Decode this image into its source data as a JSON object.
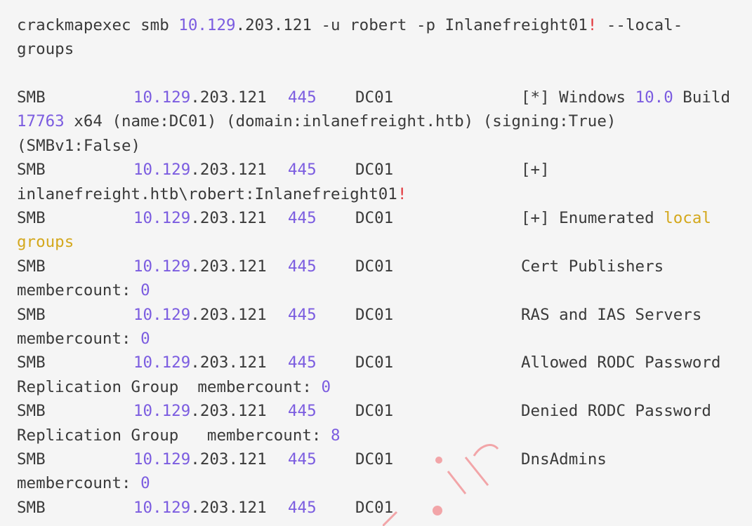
{
  "command": {
    "part1": "crackmapexec smb ",
    "ip_a": "10.129",
    "ip_b": ".203.121",
    "mid": " -u robert -p Inlanefreight01",
    "bang": "!",
    "end": " --local-",
    "line2": "groups"
  },
  "common": {
    "proto": "SMB",
    "ip_a": "10.129",
    "ip_b": ".203.121",
    "port": "445",
    "host": "DC01"
  },
  "rows": [
    {
      "parts": [
        {
          "text": "[*] Windows ",
          "style": ""
        },
        {
          "text": "10.0",
          "style": "num"
        },
        {
          "text": " Build",
          "style": ""
        }
      ],
      "wrap": [
        [
          {
            "text": "17763",
            "style": "num"
          },
          {
            "text": " x64 (name:DC01) (domain:inlanefreight.htb) (signing:True)",
            "style": ""
          }
        ],
        [
          {
            "text": "(SMBv1:False)",
            "style": ""
          }
        ]
      ]
    },
    {
      "parts": [
        {
          "text": "[+]",
          "style": ""
        }
      ],
      "wrap": [
        [
          {
            "text": "inlanefreight.htb\\robert:Inlanefreight01",
            "style": ""
          },
          {
            "text": "!",
            "style": "red"
          }
        ]
      ]
    },
    {
      "parts": [
        {
          "text": "[+] Enumerated ",
          "style": ""
        },
        {
          "text": "local",
          "style": "yel"
        }
      ],
      "wrap": [
        [
          {
            "text": "groups",
            "style": "yel"
          }
        ]
      ]
    },
    {
      "parts": [
        {
          "text": "Cert Publishers",
          "style": ""
        }
      ],
      "wrap": [
        [
          {
            "text": "membercount: ",
            "style": ""
          },
          {
            "text": "0",
            "style": "num"
          }
        ]
      ]
    },
    {
      "parts": [
        {
          "text": "RAS and IAS Servers",
          "style": ""
        }
      ],
      "wrap": [
        [
          {
            "text": "membercount: ",
            "style": ""
          },
          {
            "text": "0",
            "style": "num"
          }
        ]
      ]
    },
    {
      "parts": [
        {
          "text": "Allowed RODC Password",
          "style": ""
        }
      ],
      "wrap": [
        [
          {
            "text": "Replication Group  membercount: ",
            "style": ""
          },
          {
            "text": "0",
            "style": "num"
          }
        ]
      ]
    },
    {
      "parts": [
        {
          "text": "Denied RODC Password",
          "style": ""
        }
      ],
      "wrap": [
        [
          {
            "text": "Replication Group   membercount: ",
            "style": ""
          },
          {
            "text": "8",
            "style": "num"
          }
        ]
      ]
    },
    {
      "parts": [
        {
          "text": "DnsAdmins",
          "style": ""
        }
      ],
      "wrap": [
        [
          {
            "text": "membercount: ",
            "style": ""
          },
          {
            "text": "0",
            "style": "num"
          }
        ]
      ]
    },
    {
      "parts": [],
      "wrap": []
    }
  ],
  "watermark": {
    "text": ".ir",
    "color": "#f2a5a8"
  },
  "colors": {
    "background": "#f5f5f5",
    "text": "#3a3a3a",
    "number": "#7b5ce0",
    "error": "#e2363b",
    "highlight": "#d4a81d"
  }
}
